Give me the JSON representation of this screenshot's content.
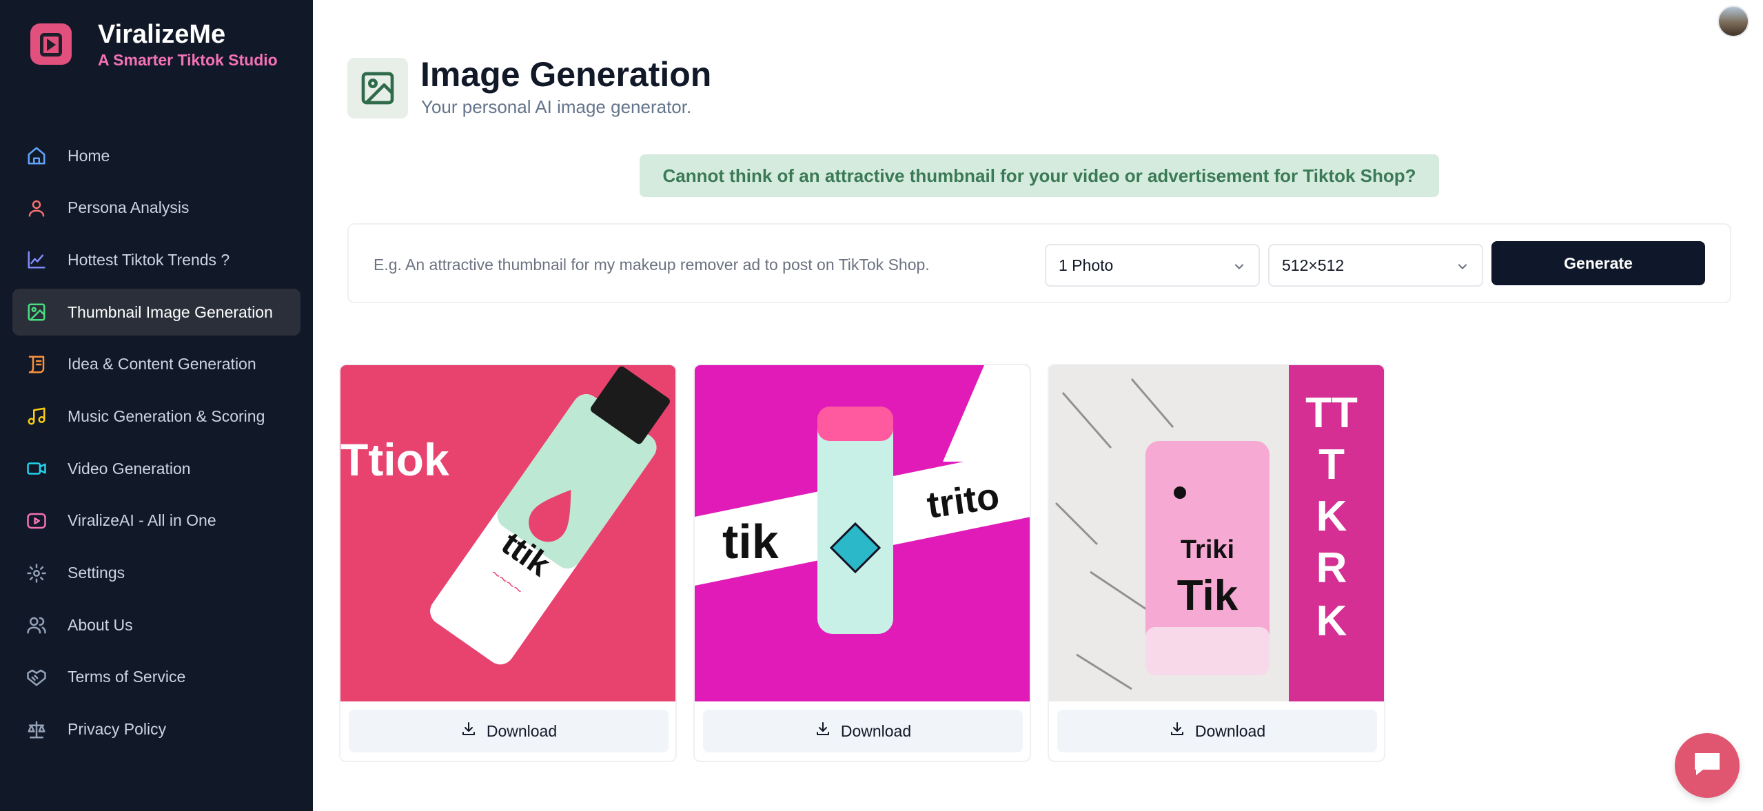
{
  "brand": {
    "name": "ViralizeMe",
    "tagline": "A Smarter Tiktok Studio"
  },
  "sidebar": {
    "items": [
      {
        "label": "Home",
        "icon": "home-icon",
        "color": "#60a5fa"
      },
      {
        "label": "Persona Analysis",
        "icon": "user-icon",
        "color": "#f87171"
      },
      {
        "label": "Hottest Tiktok Trends ?",
        "icon": "chart-icon",
        "color": "#818cf8"
      },
      {
        "label": "Thumbnail Image Generation",
        "icon": "image-icon",
        "color": "#4ade80",
        "active": true
      },
      {
        "label": "Idea & Content Generation",
        "icon": "scroll-icon",
        "color": "#fb923c"
      },
      {
        "label": "Music Generation & Scoring",
        "icon": "music-icon",
        "color": "#facc15"
      },
      {
        "label": "Video Generation",
        "icon": "video-icon",
        "color": "#22d3ee"
      },
      {
        "label": "ViralizeAI - All in One",
        "icon": "play-icon",
        "color": "#f472b6"
      },
      {
        "label": "Settings",
        "icon": "gear-icon",
        "color": "#94a3b8"
      },
      {
        "label": "About Us",
        "icon": "users-icon",
        "color": "#94a3b8"
      },
      {
        "label": "Terms of Service",
        "icon": "handshake-icon",
        "color": "#94a3b8"
      },
      {
        "label": "Privacy Policy",
        "icon": "scale-icon",
        "color": "#94a3b8"
      }
    ]
  },
  "header": {
    "title": "Image Generation",
    "subtitle": "Your personal AI image generator."
  },
  "banner": {
    "text": "Cannot think of an attractive thumbnail for your video or advertisement for Tiktok Shop?"
  },
  "prompt": {
    "placeholder": "E.g. An attractive thumbnail for my makeup remover ad to post on TikTok Shop.",
    "value": ""
  },
  "controls": {
    "count_value": "1 Photo",
    "size_value": "512×512",
    "generate_label": "Generate"
  },
  "results": [
    {
      "download_label": "Download",
      "image_text": [
        "Ttiok",
        "ttik"
      ]
    },
    {
      "download_label": "Download",
      "image_text": [
        "tik",
        "trito"
      ]
    },
    {
      "download_label": "Download",
      "image_text": [
        "TT",
        "T",
        "K",
        "R",
        "K",
        "Triki",
        "Tik"
      ]
    }
  ],
  "colors": {
    "sidebar_bg": "#111827",
    "brand_pink": "#f472b6",
    "banner_bg": "#d5ebdd",
    "banner_text": "#3b7a57",
    "primary_button": "#0f172a",
    "chat_fab": "#e0556f"
  }
}
